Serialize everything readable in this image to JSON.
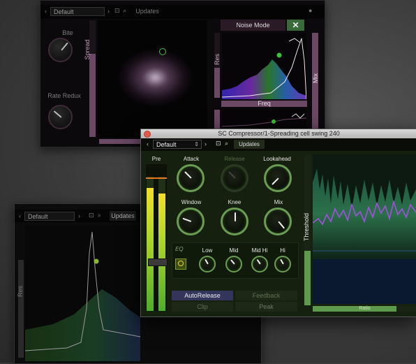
{
  "windowA": {
    "preset": "Default",
    "updates": "Updates",
    "bite_label": "Bite",
    "rate_redux_label": "Rate Redux",
    "spread_label": "Spread",
    "noise_mode_label": "Noise Mode",
    "res_label": "Res",
    "freq_label": "Freq",
    "mix_label": "Mix"
  },
  "windowB": {
    "title": "SC Compressor/1-Spreading cell swing 240",
    "preset": "Default",
    "updates": "Updates",
    "pre_label": "Pre",
    "knobs": {
      "attack": "Attack",
      "release": "Release",
      "lookahead": "Lookahead",
      "window": "Window",
      "knee": "Knee",
      "mix": "Mix"
    },
    "eq": {
      "label": "EQ",
      "low": "Low",
      "mid": "Mid",
      "mid_hi": "Mid Hi",
      "hi": "Hi"
    },
    "buttons": {
      "autorelease": "AutoRelease",
      "feedback": "Feedback",
      "clip": "Clip",
      "peak": "Peak"
    },
    "threshold_label": "Threshold",
    "ratio_label": "Ratio"
  },
  "windowC": {
    "preset": "Default",
    "updates": "Updates",
    "res_label": "Res"
  },
  "colors": {
    "green_accent": "#6b9c54",
    "meter_green": "#a8d82e",
    "pink_accent": "#c48fb5",
    "purple_line": "#a150e0"
  }
}
